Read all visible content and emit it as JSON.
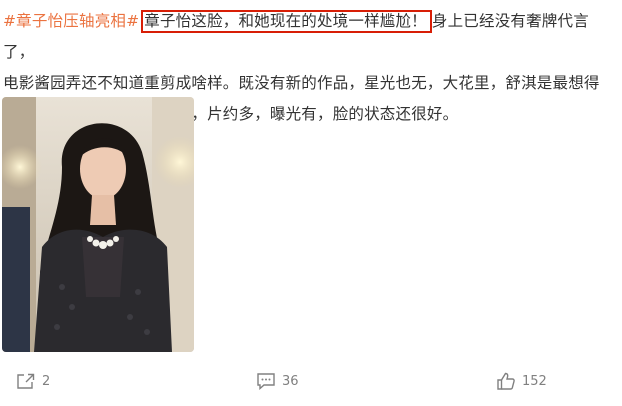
{
  "post": {
    "hashtag": "#章子怡压轴亮相#",
    "highlight": "章子怡这脸，和她现在的处境一样尴尬！",
    "line1_rest": "身上已经没有奢牌代言了，",
    "line2": "电影酱园弄还不知道重剪成啥样。既没有新的作品，星光也无，大花里，舒淇是最想得",
    "line3": "明白的，给年轻流量做二番，片约多，曝光有，脸的状态还很好。"
  },
  "photo": {
    "alt": "woman with long wavy hair and a pearl necklace"
  },
  "actions": {
    "share_count": "2",
    "comment_count": "36",
    "like_count": "152"
  },
  "colors": {
    "hashtag": "#eb7340",
    "highlight_border": "#d81e06",
    "text": "#333333",
    "action_text": "#808080"
  }
}
